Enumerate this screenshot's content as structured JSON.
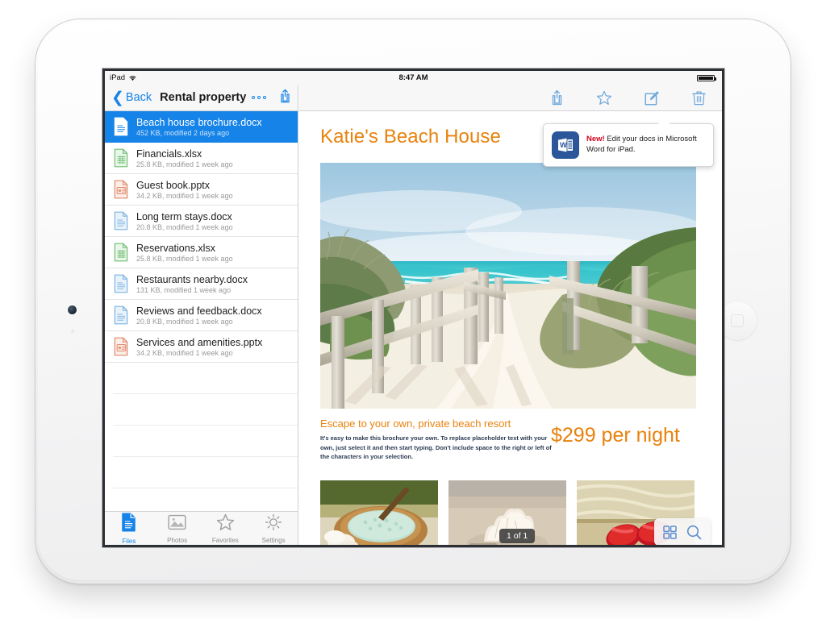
{
  "device": {
    "name": "iPad Air",
    "color": "silver"
  },
  "status_bar": {
    "carrier": "iPad",
    "wifi_icon": "wifi-icon",
    "time": "8:47 AM",
    "battery_icon": "battery-full-icon"
  },
  "sidebar": {
    "nav": {
      "back_label": "Back",
      "back_icon": "chevron-left-icon",
      "title": "Rental property",
      "more_icon": "more-dots-icon",
      "share_icon": "share-icon"
    },
    "files": [
      {
        "name": "Beach house brochure.docx",
        "meta": "452 KB, modified 2 days ago",
        "type": "docx",
        "selected": true
      },
      {
        "name": "Financials.xlsx",
        "meta": "25.8 KB, modified 1 week ago",
        "type": "xlsx",
        "selected": false
      },
      {
        "name": "Guest book.pptx",
        "meta": "34.2 KB, modified 1 week ago",
        "type": "pptx",
        "selected": false
      },
      {
        "name": "Long term stays.docx",
        "meta": "20.8 KB, modified 1 week ago",
        "type": "docx",
        "selected": false
      },
      {
        "name": "Reservations.xlsx",
        "meta": "25.8 KB, modified 1 week ago",
        "type": "xlsx",
        "selected": false
      },
      {
        "name": "Restaurants nearby.docx",
        "meta": "131 KB, modified 1 week ago",
        "type": "docx",
        "selected": false
      },
      {
        "name": "Reviews and feedback.docx",
        "meta": "20.8 KB, modified 1 week ago",
        "type": "docx",
        "selected": false
      },
      {
        "name": "Services and amenities.pptx",
        "meta": "34.2 KB, modified 1 week ago",
        "type": "pptx",
        "selected": false
      }
    ],
    "tabs": [
      {
        "label": "Files",
        "icon": "file-icon",
        "active": true
      },
      {
        "label": "Photos",
        "icon": "photo-icon",
        "active": false
      },
      {
        "label": "Favorites",
        "icon": "star-icon",
        "active": false
      },
      {
        "label": "Settings",
        "icon": "gear-icon",
        "active": false
      }
    ]
  },
  "document": {
    "toolbar": [
      {
        "icon": "share-icon",
        "name": "share-button"
      },
      {
        "icon": "star-icon",
        "name": "favorite-button"
      },
      {
        "icon": "edit-pencil-icon",
        "name": "edit-button"
      },
      {
        "icon": "trash-icon",
        "name": "delete-button"
      }
    ],
    "title": "Katie's Beach House",
    "subheading": "Escape to your own, private beach resort",
    "body": "It's easy to make this brochure your own. To replace placeholder text with your own, just select it and then start typing. Don't include space to the right or left of the characters in your selection.",
    "price": "$299 per night",
    "page_badge": "1 of 1",
    "hero_alt": "beach-path-photo",
    "thumbnails": [
      {
        "alt": "bath-salts-bowl-photo"
      },
      {
        "alt": "seashell-on-sand-photo"
      },
      {
        "alt": "red-flip-flops-towel-photo"
      }
    ],
    "float_controls": [
      {
        "icon": "grid-view-icon",
        "name": "thumbnail-view-button"
      },
      {
        "icon": "search-icon",
        "name": "search-button"
      }
    ]
  },
  "tooltip": {
    "app_icon": "microsoft-word-icon",
    "badge": "New!",
    "message": " Edit your docs in Microsoft Word for iPad."
  },
  "colors": {
    "accent_blue": "#1583e8",
    "brand_orange": "#e8820c",
    "word_blue": "#2b579a",
    "alert_red": "#d0021b"
  }
}
